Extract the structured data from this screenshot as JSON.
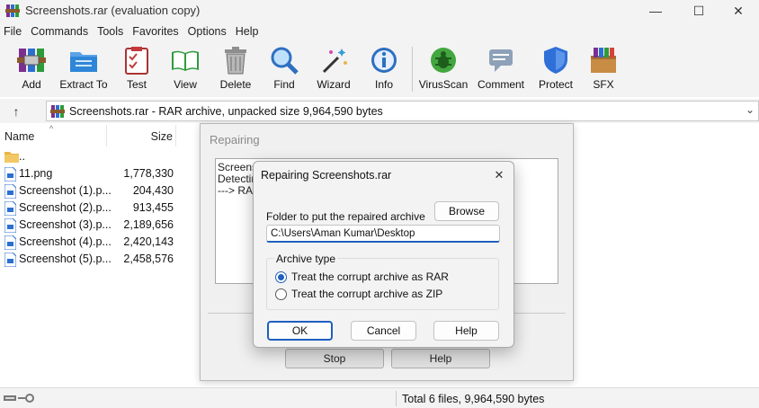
{
  "window": {
    "title": "Screenshots.rar (evaluation copy)",
    "controls": {
      "minimize": "—",
      "maximize": "☐",
      "close": "✕"
    }
  },
  "menu": [
    "File",
    "Commands",
    "Tools",
    "Favorites",
    "Options",
    "Help"
  ],
  "toolbar": [
    {
      "label": "Add",
      "icon": "books-stack-icon"
    },
    {
      "label": "Extract To",
      "icon": "folder-extract-icon"
    },
    {
      "label": "Test",
      "icon": "clipboard-check-icon"
    },
    {
      "label": "View",
      "icon": "open-book-icon"
    },
    {
      "label": "Delete",
      "icon": "trash-can-icon"
    },
    {
      "label": "Find",
      "icon": "magnifier-icon"
    },
    {
      "label": "Wizard",
      "icon": "magic-wand-icon"
    },
    {
      "label": "Info",
      "icon": "info-icon"
    },
    {
      "label": "VirusScan",
      "icon": "bug-scan-icon"
    },
    {
      "label": "Comment",
      "icon": "comment-icon"
    },
    {
      "label": "Protect",
      "icon": "shield-icon"
    },
    {
      "label": "SFX",
      "icon": "sfx-box-icon"
    }
  ],
  "address": {
    "up": "↑",
    "text": "Screenshots.rar - RAR archive, unpacked size 9,964,590 bytes",
    "chevron": "⌄"
  },
  "filelist": {
    "columns": {
      "name": "Name",
      "size": "Size",
      "sort_arrow": "^"
    },
    "parent": "..",
    "rows": [
      {
        "name": "11.png",
        "size": "1,778,330"
      },
      {
        "name": "Screenshot (1).p...",
        "size": "204,430"
      },
      {
        "name": "Screenshot (2).p...",
        "size": "913,455"
      },
      {
        "name": "Screenshot (3).p...",
        "size": "2,189,656"
      },
      {
        "name": "Screenshot (4).p...",
        "size": "2,420,143"
      },
      {
        "name": "Screenshot (5).p...",
        "size": "2,458,576"
      }
    ]
  },
  "status": {
    "text": "Total 6 files, 9,964,590 bytes"
  },
  "repair_window": {
    "title": "Repairing",
    "log": [
      "Screensh",
      "Detectin",
      "---> RAR"
    ],
    "stop": "Stop",
    "help": "Help"
  },
  "dialog": {
    "title": "Repairing Screenshots.rar",
    "close": "✕",
    "folder_label": "Folder to put the repaired archive",
    "browse": "Browse",
    "folder_value": "C:\\Users\\Aman Kumar\\Desktop",
    "archive_type_label": "Archive type",
    "options": [
      {
        "label": "Treat the corrupt archive as RAR",
        "checked": true
      },
      {
        "label": "Treat the corrupt archive as ZIP",
        "checked": false
      }
    ],
    "ok": "OK",
    "cancel": "Cancel",
    "help": "Help"
  },
  "colors": {
    "chrome": "#f3f3f3",
    "accent": "#1f5fbf",
    "folder": "#e8b64a"
  }
}
